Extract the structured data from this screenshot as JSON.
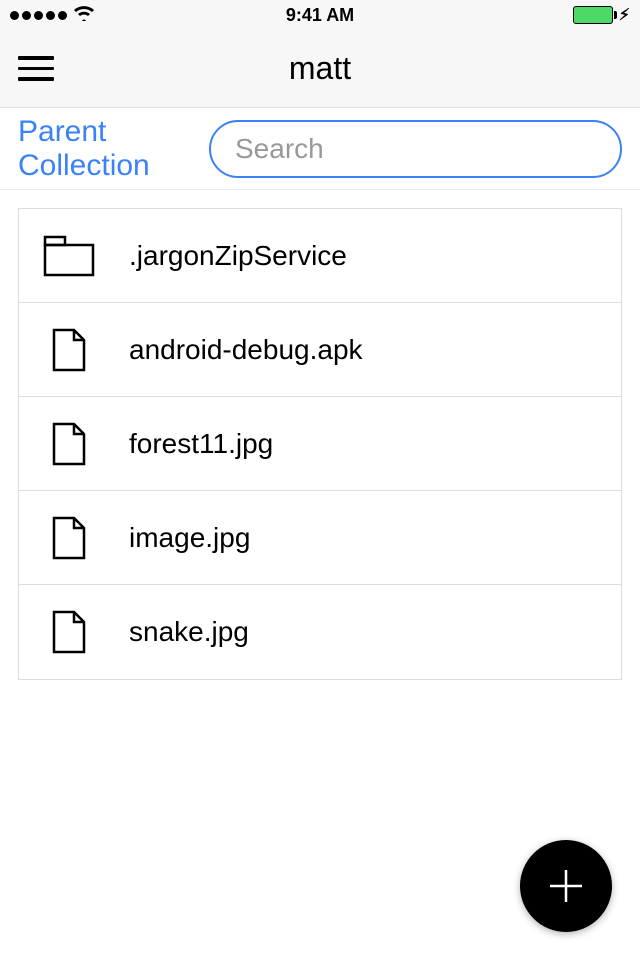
{
  "statusBar": {
    "time": "9:41 AM"
  },
  "header": {
    "title": "matt"
  },
  "actions": {
    "parentLink": "Parent Collection",
    "searchPlaceholder": "Search"
  },
  "files": [
    {
      "type": "folder",
      "name": ".jargonZipService"
    },
    {
      "type": "file",
      "name": "android-debug.apk"
    },
    {
      "type": "file",
      "name": "forest11.jpg"
    },
    {
      "type": "file",
      "name": "image.jpg"
    },
    {
      "type": "file",
      "name": "snake.jpg"
    }
  ]
}
